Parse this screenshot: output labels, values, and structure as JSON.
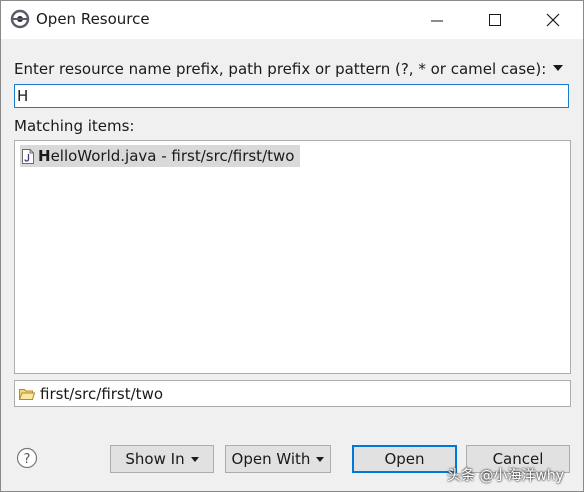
{
  "window": {
    "title": "Open Resource"
  },
  "prompt": {
    "label": "Enter resource name prefix, path prefix or pattern (?, * or camel case):"
  },
  "search": {
    "value": "H"
  },
  "matching": {
    "label": "Matching items:",
    "items": [
      {
        "match_prefix": "H",
        "rest": "elloWorld.java - first/src/first/two",
        "icon": "java-file-icon"
      }
    ]
  },
  "status": {
    "path": "first/src/first/two",
    "icon": "folder-icon"
  },
  "buttons": {
    "show_in": "Show In",
    "open_with": "Open With",
    "open": "Open",
    "cancel": "Cancel"
  },
  "watermark": "头条 @小海洋why",
  "colors": {
    "focus_border": "#1c7bd0",
    "selection_bg": "#d9d9d9",
    "default_button_border": "#0078d7",
    "dialog_bg": "#f0f0f0"
  }
}
